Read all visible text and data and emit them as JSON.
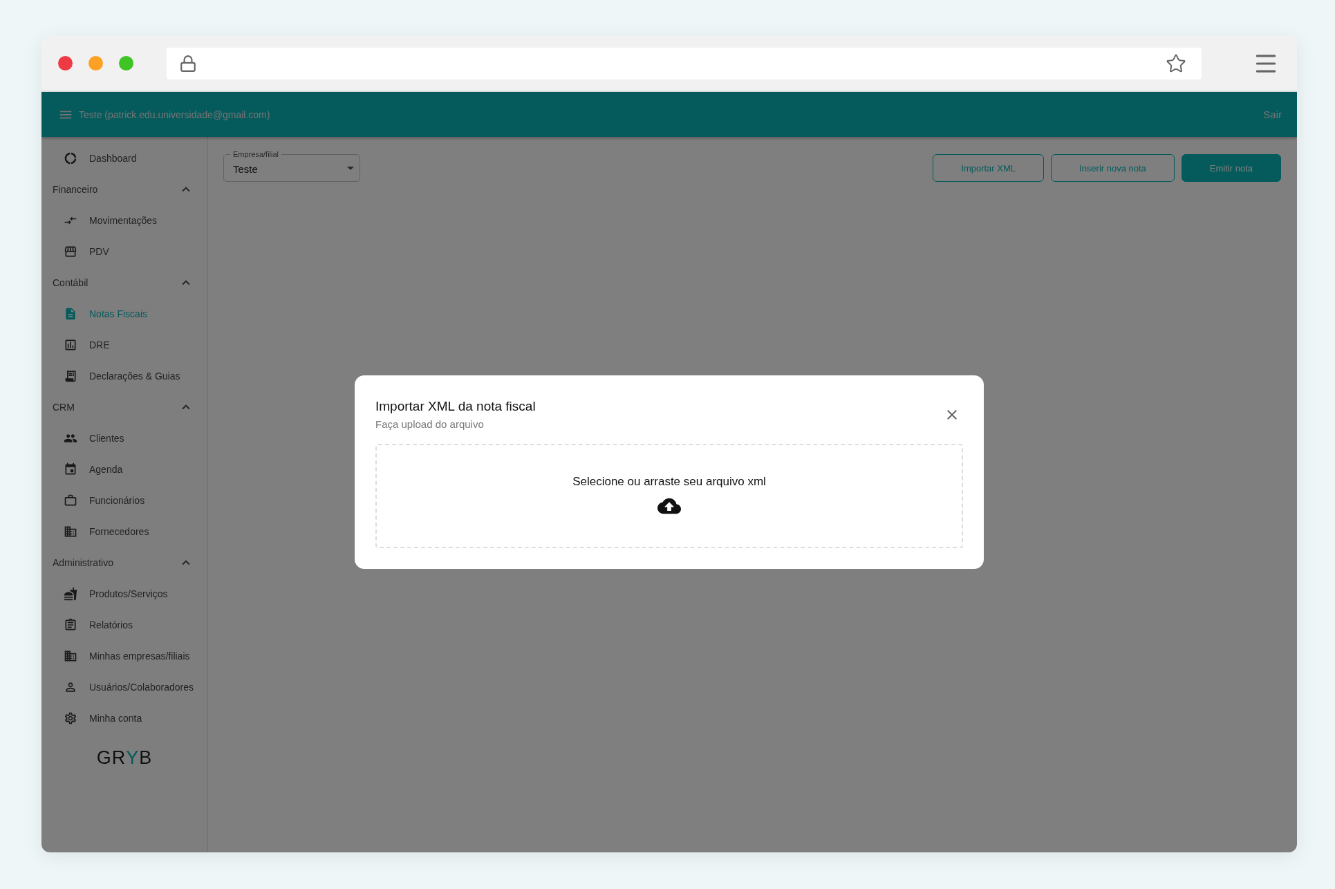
{
  "header": {
    "user": "Teste (patrick.edu.universidade@gmail.com)",
    "logout": "Sair"
  },
  "sidebar": {
    "items": [
      {
        "label": "Dashboard",
        "selected": false
      }
    ],
    "groups": [
      {
        "title": "Financeiro",
        "expanded": true,
        "items": [
          {
            "label": "Movimentações",
            "selected": false
          },
          {
            "label": "PDV",
            "selected": false
          }
        ]
      },
      {
        "title": "Contábil",
        "expanded": true,
        "items": [
          {
            "label": "Notas Fiscais",
            "selected": true
          },
          {
            "label": "DRE",
            "selected": false
          },
          {
            "label": "Declarações & Guias",
            "selected": false
          }
        ]
      },
      {
        "title": "CRM",
        "expanded": true,
        "items": [
          {
            "label": "Clientes",
            "selected": false
          },
          {
            "label": "Agenda",
            "selected": false
          },
          {
            "label": "Funcionários",
            "selected": false
          },
          {
            "label": "Fornecedores",
            "selected": false
          }
        ]
      },
      {
        "title": "Administrativo",
        "expanded": true,
        "items": [
          {
            "label": "Produtos/Serviços",
            "selected": false
          },
          {
            "label": "Relatórios",
            "selected": false
          },
          {
            "label": "Minhas empresas/filiais",
            "selected": false
          },
          {
            "label": "Usuários/Colaboradores",
            "selected": false
          },
          {
            "label": "Minha conta",
            "selected": false
          }
        ]
      }
    ],
    "logo": [
      {
        "text": "GR",
        "accent": false
      },
      {
        "text": "Y",
        "accent": true
      },
      {
        "text": "B",
        "accent": false
      }
    ]
  },
  "toolbar": {
    "company_select": {
      "label": "Empresa/filial",
      "value": "Teste"
    },
    "buttons": [
      {
        "label": "Importar XML",
        "kind": "outlined"
      },
      {
        "label": "Inserir nova nota",
        "kind": "outlined"
      },
      {
        "label": "Emitir nota",
        "kind": "filled"
      }
    ]
  },
  "dialog": {
    "title": "Importar XML da nota fiscal",
    "subtitle": "Faça upload do arquivo",
    "dropzone": {
      "text": "Selecione ou arraste seu arquivo xml"
    }
  }
}
